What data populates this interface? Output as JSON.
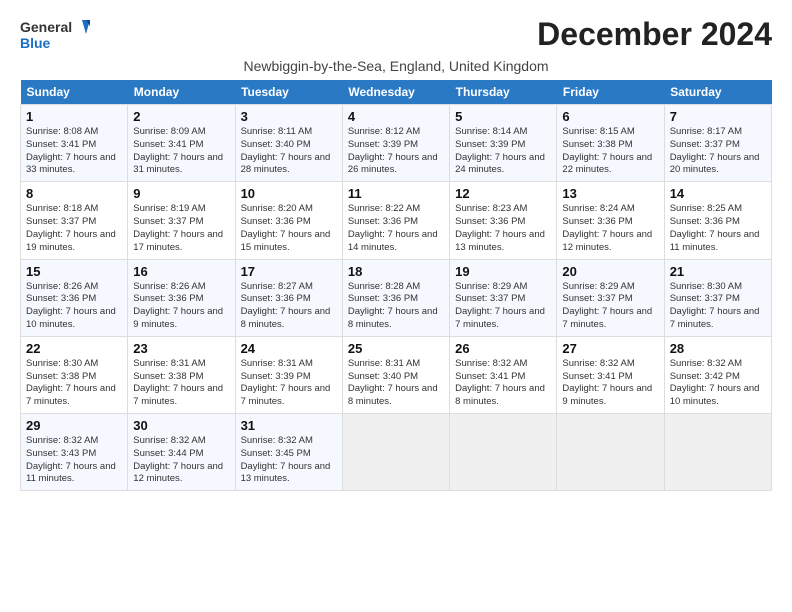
{
  "logo": {
    "line1": "General",
    "line2": "Blue"
  },
  "title": "December 2024",
  "subtitle": "Newbiggin-by-the-Sea, England, United Kingdom",
  "days_of_week": [
    "Sunday",
    "Monday",
    "Tuesday",
    "Wednesday",
    "Thursday",
    "Friday",
    "Saturday"
  ],
  "weeks": [
    [
      {
        "day": "1",
        "sunrise": "8:08 AM",
        "sunset": "3:41 PM",
        "daylight": "7 hours and 33 minutes."
      },
      {
        "day": "2",
        "sunrise": "8:09 AM",
        "sunset": "3:41 PM",
        "daylight": "7 hours and 31 minutes."
      },
      {
        "day": "3",
        "sunrise": "8:11 AM",
        "sunset": "3:40 PM",
        "daylight": "7 hours and 28 minutes."
      },
      {
        "day": "4",
        "sunrise": "8:12 AM",
        "sunset": "3:39 PM",
        "daylight": "7 hours and 26 minutes."
      },
      {
        "day": "5",
        "sunrise": "8:14 AM",
        "sunset": "3:39 PM",
        "daylight": "7 hours and 24 minutes."
      },
      {
        "day": "6",
        "sunrise": "8:15 AM",
        "sunset": "3:38 PM",
        "daylight": "7 hours and 22 minutes."
      },
      {
        "day": "7",
        "sunrise": "8:17 AM",
        "sunset": "3:37 PM",
        "daylight": "7 hours and 20 minutes."
      }
    ],
    [
      {
        "day": "8",
        "sunrise": "8:18 AM",
        "sunset": "3:37 PM",
        "daylight": "7 hours and 19 minutes."
      },
      {
        "day": "9",
        "sunrise": "8:19 AM",
        "sunset": "3:37 PM",
        "daylight": "7 hours and 17 minutes."
      },
      {
        "day": "10",
        "sunrise": "8:20 AM",
        "sunset": "3:36 PM",
        "daylight": "7 hours and 15 minutes."
      },
      {
        "day": "11",
        "sunrise": "8:22 AM",
        "sunset": "3:36 PM",
        "daylight": "7 hours and 14 minutes."
      },
      {
        "day": "12",
        "sunrise": "8:23 AM",
        "sunset": "3:36 PM",
        "daylight": "7 hours and 13 minutes."
      },
      {
        "day": "13",
        "sunrise": "8:24 AM",
        "sunset": "3:36 PM",
        "daylight": "7 hours and 12 minutes."
      },
      {
        "day": "14",
        "sunrise": "8:25 AM",
        "sunset": "3:36 PM",
        "daylight": "7 hours and 11 minutes."
      }
    ],
    [
      {
        "day": "15",
        "sunrise": "8:26 AM",
        "sunset": "3:36 PM",
        "daylight": "7 hours and 10 minutes."
      },
      {
        "day": "16",
        "sunrise": "8:26 AM",
        "sunset": "3:36 PM",
        "daylight": "7 hours and 9 minutes."
      },
      {
        "day": "17",
        "sunrise": "8:27 AM",
        "sunset": "3:36 PM",
        "daylight": "7 hours and 8 minutes."
      },
      {
        "day": "18",
        "sunrise": "8:28 AM",
        "sunset": "3:36 PM",
        "daylight": "7 hours and 8 minutes."
      },
      {
        "day": "19",
        "sunrise": "8:29 AM",
        "sunset": "3:37 PM",
        "daylight": "7 hours and 7 minutes."
      },
      {
        "day": "20",
        "sunrise": "8:29 AM",
        "sunset": "3:37 PM",
        "daylight": "7 hours and 7 minutes."
      },
      {
        "day": "21",
        "sunrise": "8:30 AM",
        "sunset": "3:37 PM",
        "daylight": "7 hours and 7 minutes."
      }
    ],
    [
      {
        "day": "22",
        "sunrise": "8:30 AM",
        "sunset": "3:38 PM",
        "daylight": "7 hours and 7 minutes."
      },
      {
        "day": "23",
        "sunrise": "8:31 AM",
        "sunset": "3:38 PM",
        "daylight": "7 hours and 7 minutes."
      },
      {
        "day": "24",
        "sunrise": "8:31 AM",
        "sunset": "3:39 PM",
        "daylight": "7 hours and 7 minutes."
      },
      {
        "day": "25",
        "sunrise": "8:31 AM",
        "sunset": "3:40 PM",
        "daylight": "7 hours and 8 minutes."
      },
      {
        "day": "26",
        "sunrise": "8:32 AM",
        "sunset": "3:41 PM",
        "daylight": "7 hours and 8 minutes."
      },
      {
        "day": "27",
        "sunrise": "8:32 AM",
        "sunset": "3:41 PM",
        "daylight": "7 hours and 9 minutes."
      },
      {
        "day": "28",
        "sunrise": "8:32 AM",
        "sunset": "3:42 PM",
        "daylight": "7 hours and 10 minutes."
      }
    ],
    [
      {
        "day": "29",
        "sunrise": "8:32 AM",
        "sunset": "3:43 PM",
        "daylight": "7 hours and 11 minutes."
      },
      {
        "day": "30",
        "sunrise": "8:32 AM",
        "sunset": "3:44 PM",
        "daylight": "7 hours and 12 minutes."
      },
      {
        "day": "31",
        "sunrise": "8:32 AM",
        "sunset": "3:45 PM",
        "daylight": "7 hours and 13 minutes."
      },
      null,
      null,
      null,
      null
    ]
  ],
  "labels": {
    "sunrise": "Sunrise:",
    "sunset": "Sunset:",
    "daylight": "Daylight:"
  }
}
